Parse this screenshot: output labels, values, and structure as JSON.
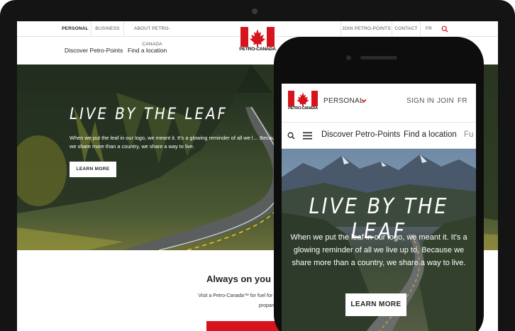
{
  "desktop": {
    "topbar": {
      "left_links": [
        "PERSONAL",
        "BUSINESS",
        "ABOUT PETRO-CANADA"
      ],
      "right_links": [
        "JOIN PETRO-POINTS",
        "CONTACT",
        "FR"
      ],
      "search_icon": "search-icon"
    },
    "logo_text": "PETRO-CANADA",
    "nav": [
      "Discover Petro-Points",
      "Find a location"
    ],
    "hero": {
      "title": "LIVE BY THE LEAF",
      "body": "When we put the leaf in our logo, we meant it. It's a glowing reminder of all we l… Because we share more than a country, we share a way to live.",
      "button": "LEARN MORE"
    },
    "section": {
      "title": "Always on you",
      "text_line1": "Visit a Petro-Canada™ for fuel for you and your car. ",
      "text_line2": "propane tank refill and a"
    }
  },
  "mobile": {
    "header": {
      "logo_text": "PETRO-CANADA",
      "personal": "PERSONAL",
      "links": [
        "SIGN IN",
        "JOIN",
        "FR"
      ]
    },
    "nav": [
      "Discover Petro-Points",
      "Find a location",
      "Fu"
    ],
    "hero": {
      "title": "LIVE BY THE LEAF",
      "body": "When we put the leaf in our logo, we meant it. It's a glowing reminder of all we live up to. Because we share more than a country, we share a way to live.",
      "button": "LEARN MORE"
    }
  },
  "colors": {
    "brand_red": "#d7141e",
    "text_dark": "#222222",
    "divider": "#e3e3e3"
  }
}
